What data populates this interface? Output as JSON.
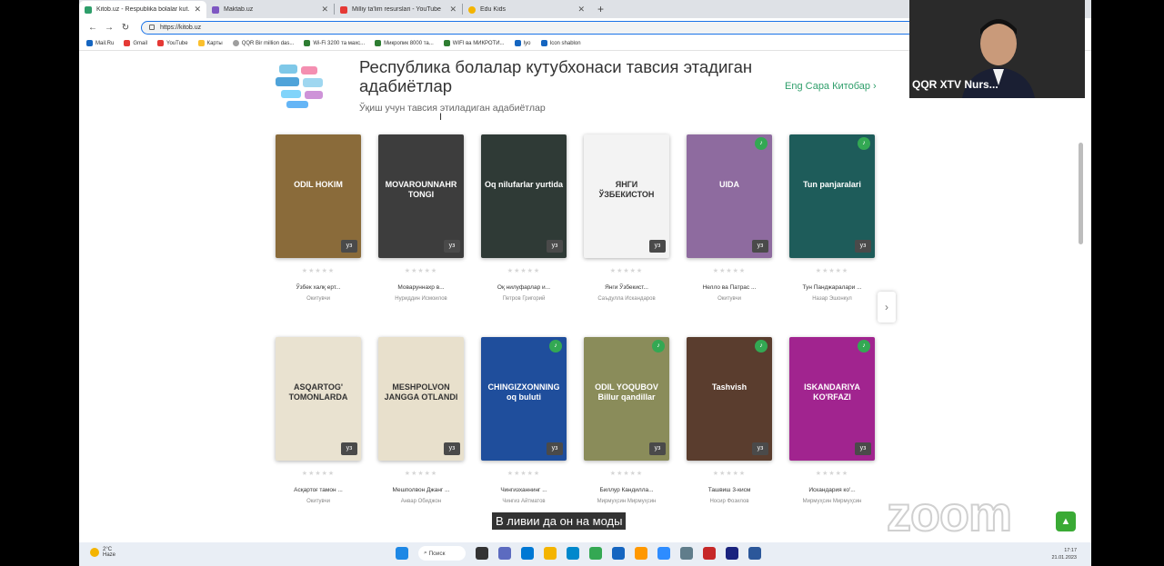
{
  "browser": {
    "tabs": [
      {
        "label": "Kitob.uz - Respublika bolalar kut...",
        "color": "#2e9e6a"
      },
      {
        "label": "Maktab.uz",
        "color": "#7e57c2"
      },
      {
        "label": "Milliy ta'lim resurslari - YouTube",
        "color": "#e53935"
      },
      {
        "label": "Edu Kids",
        "color": "#f4b400"
      }
    ],
    "url": "https://kitob.uz",
    "bookmarks": [
      {
        "label": "Mail.Ru",
        "color": "#1565c0"
      },
      {
        "label": "Gmail",
        "color": "#e53935"
      },
      {
        "label": "YouTube",
        "color": "#e53935"
      },
      {
        "label": "Карты",
        "color": "#fbc02d"
      },
      {
        "label": "QQR Bir million das...",
        "color": "#9e9e9e"
      },
      {
        "label": "Wi-Fi 3200 та махс...",
        "color": "#2e7d32"
      },
      {
        "label": "Микропик 8000 та...",
        "color": "#2e7d32"
      },
      {
        "label": "WIFI ва МИКРОТИ...",
        "color": "#2e7d32"
      },
      {
        "label": "Iyo",
        "color": "#1565c0"
      },
      {
        "label": "Icon shablon",
        "color": "#1565c0"
      }
    ]
  },
  "page": {
    "title": "Республика болалар кутубхонаси тавсия этадиган адабиётлар",
    "subtitle": "Ўқиш учун тавсия этиладиган адабиётлар",
    "more_link": "Eng Сара Китобар ›",
    "lang_badge": "уз",
    "stars": "★★★★★",
    "books": [
      {
        "title": "Ўзбек халқ ерт...",
        "author": "Окитувчи",
        "cover_text": "ODIL HOKIM",
        "color": "#8a6b3a",
        "audio": false
      },
      {
        "title": "Моваруннахр в...",
        "author": "Нуриддин Исмоилов",
        "cover_text": "MOVAROUNNAHR TONGI",
        "color": "#3d3d3d",
        "audio": false
      },
      {
        "title": "Оқ нилуфарлар и...",
        "author": "Петров Григорий",
        "cover_text": "Oq nilufarlar yurtida",
        "color": "#2f3a36",
        "audio": false
      },
      {
        "title": "Янги Ўзбекист...",
        "author": "Саъдулла Искандаров",
        "cover_text": "ЯНГИ ЎЗБЕКИСТОН",
        "color": "#f3f3f3",
        "audio": false
      },
      {
        "title": "Нелло ва Патрас ...",
        "author": "Окитувчи",
        "cover_text": "UIDA",
        "color": "#8e6b9f",
        "audio": true
      },
      {
        "title": "Тун Панджаралари ...",
        "author": "Назар Эшонкул",
        "cover_text": "Tun panjaralari",
        "color": "#1e5c5a",
        "audio": true
      },
      {
        "title": "Асқартоғ тамон ...",
        "author": "Окитувчи",
        "cover_text": "ASQARTOG' TOMONLARDA",
        "color": "#e9e2d0",
        "audio": false
      },
      {
        "title": "Мешполвон Джанг ...",
        "author": "Анвар Обиджон",
        "cover_text": "MESHPOLVON JANGGA OTLANDI",
        "color": "#e8e0cc",
        "audio": false
      },
      {
        "title": "Чингизханнинг ...",
        "author": "Чингиз Айтматов",
        "cover_text": "CHINGIZXONNING oq buluti",
        "color": "#1f4e9c",
        "audio": true
      },
      {
        "title": "Биллур Кандилла...",
        "author": "Мирмуҳсин Мирмуҳсин",
        "cover_text": "ODIL YOQUBOV Billur qandillar",
        "color": "#8a8c5a",
        "audio": true
      },
      {
        "title": "Ташвиш 3-кисм",
        "author": "Носир Фозилов",
        "cover_text": "Tashvish",
        "color": "#5a3d2e",
        "audio": true
      },
      {
        "title": "Искандария ко'...",
        "author": "Мирмуҳсин Мирмуҳсин",
        "cover_text": "ISKANDARIYA KO'RFAZI",
        "color": "#a1248f",
        "audio": true
      }
    ]
  },
  "caption": "В ливии да он на моды",
  "taskbar": {
    "temp": "2°C",
    "weather": "Haze",
    "search": "Поиск",
    "time": "17:17",
    "date": "21.01.2023",
    "apps": [
      "#1e88e5",
      "#333333",
      "#5c6bc0",
      "#0078d4",
      "#f4b400",
      "#0088cc",
      "#34a853",
      "#1565c0",
      "#ff9800",
      "#2d8cff",
      "#607d8b",
      "#c62828",
      "#1a237e",
      "#2b579a"
    ]
  },
  "zoom": {
    "participant": "QQR XTV Nurs...",
    "watermark": "zoom"
  }
}
